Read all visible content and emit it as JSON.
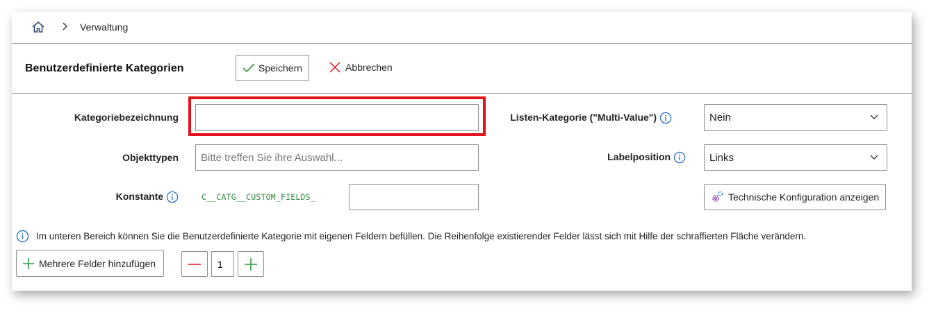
{
  "breadcrumb": {
    "home_icon": "home-icon",
    "separator_icon": "chevron-right-icon",
    "current": "Verwaltung"
  },
  "header": {
    "title": "Benutzerdefinierte Kategorien",
    "save_label": "Speichern",
    "cancel_label": "Abbrechen"
  },
  "form": {
    "category_name": {
      "label": "Kategoriebezeichnung",
      "value": ""
    },
    "object_types": {
      "label": "Objekttypen",
      "placeholder": "Bitte treffen Sie ihre Auswahl...",
      "value": ""
    },
    "constant": {
      "label": "Konstante",
      "prefix": "C__CATG__CUSTOM_FIELDS_",
      "value": ""
    },
    "multi_value": {
      "label": "Listen-Kategorie (\"Multi-Value\")",
      "selected": "Nein"
    },
    "label_position": {
      "label": "Labelposition",
      "selected": "Links"
    },
    "tech_config_label": "Technische Konfiguration anzeigen"
  },
  "info_text": "Im unteren Bereich können Sie die Benutzerdefinierte Kategorie mit eigenen Feldern befüllen. Die Reihenfolge existierender Felder lässt sich mit Hilfe der schraffierten Fläche verändern.",
  "fields": {
    "add_label": "Mehrere Felder hinzufügen",
    "count": "1"
  },
  "colors": {
    "accent_info": "#2a73c6",
    "success_green": "#2e9a3e",
    "danger_red": "#e3131b"
  }
}
